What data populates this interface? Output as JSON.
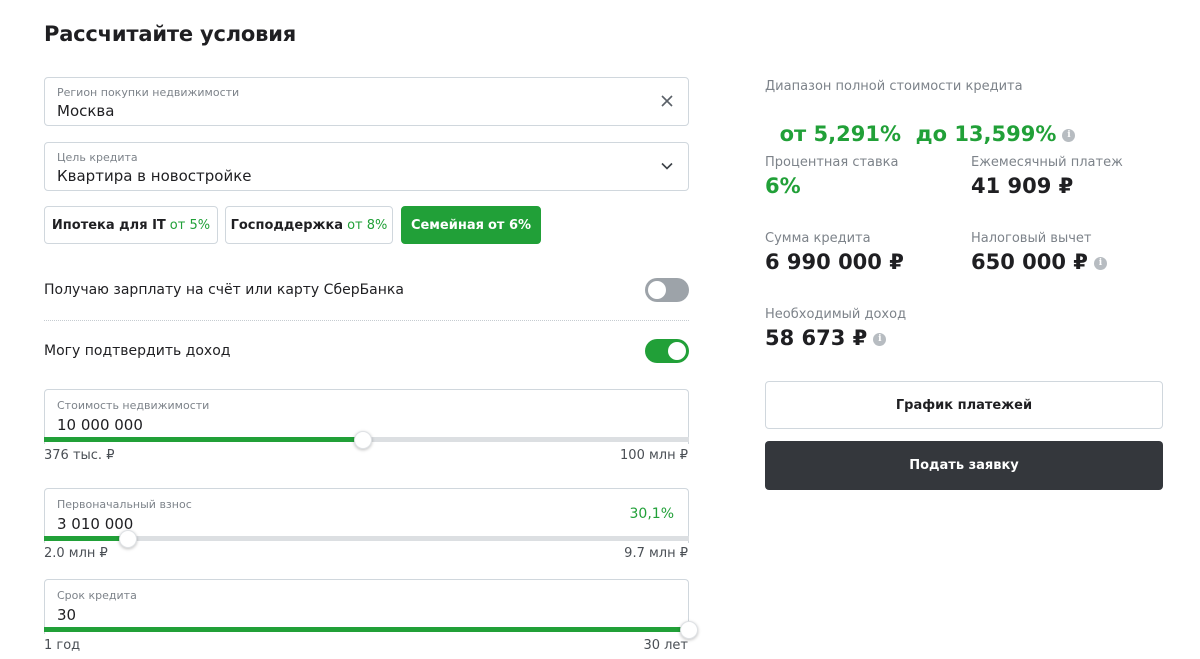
{
  "title": "Рассчитайте условия",
  "region": {
    "label": "Регион покупки недвижимости",
    "value": "Москва",
    "clear_icon": "close-icon"
  },
  "purpose": {
    "label": "Цель кредита",
    "value": "Квартира в новостройке",
    "dropdown_icon": "chevron-down-icon"
  },
  "programs": [
    {
      "name": "Ипотека для IT",
      "rate": "от 5%",
      "active": false
    },
    {
      "name": "Господдержка",
      "rate": "от 8%",
      "active": false
    },
    {
      "name": "Семейная",
      "rate": "от 6%",
      "active": true
    }
  ],
  "toggles": {
    "salary": {
      "label": "Получаю зарплату на счёт или карту СберБанка",
      "on": false
    },
    "income": {
      "label": "Могу подтвердить доход",
      "on": true
    }
  },
  "property_cost": {
    "label": "Стоимость недвижимости",
    "value": "10 000 000",
    "min": "376 тыс. ₽",
    "max": "100 млн ₽",
    "fraction": 0.495
  },
  "down_payment": {
    "label": "Первоначальный взнос",
    "value": "3 010 000",
    "percent": "30,1%",
    "min": "2.0 млн ₽",
    "max": "9.7 млн ₽",
    "fraction": 0.13
  },
  "term": {
    "label": "Срок кредита",
    "value": "30",
    "min": "1 год",
    "max": "30 лет",
    "fraction": 1.0
  },
  "summary": {
    "range_label": "Диапазон полной стоимости кредита",
    "range_value": "от 5,291%  до 13,599%",
    "rate_label": "Процентная ставка",
    "rate_value": "6%",
    "monthly_label": "Ежемесячный платеж",
    "monthly_value": "41 909 ₽",
    "loan_label": "Сумма кредита",
    "loan_value": "6 990 000 ₽",
    "tax_label": "Налоговый вычет",
    "tax_value": "650 000 ₽",
    "income_label": "Необходимый доход",
    "income_value": "58 673 ₽",
    "info_glyph": "i"
  },
  "buttons": {
    "schedule": "График платежей",
    "apply": "Подать заявку"
  },
  "colors": {
    "accent": "#21a038",
    "dark_button": "#34373c",
    "toggle_off": "#9da3a9"
  }
}
